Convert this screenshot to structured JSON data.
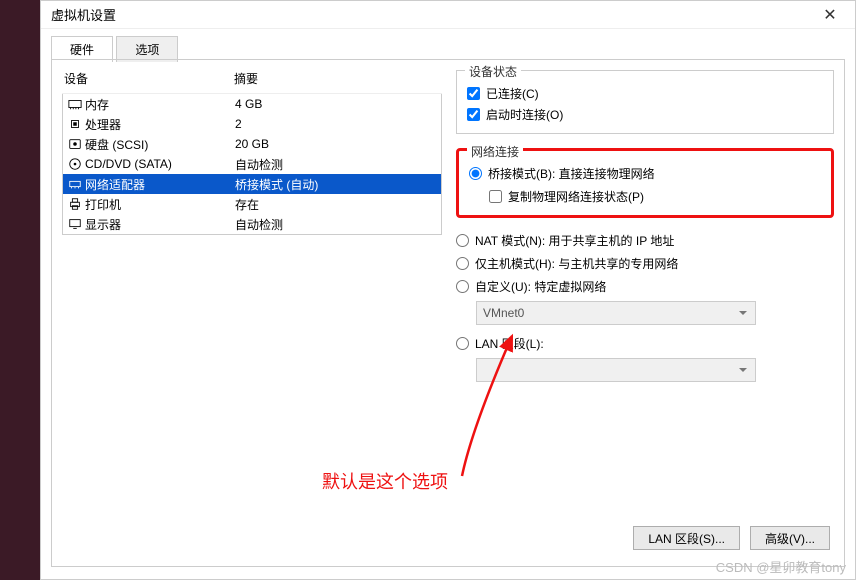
{
  "title": "虚拟机设置",
  "tabs": {
    "hardware": "硬件",
    "options": "选项"
  },
  "headers": {
    "device": "设备",
    "summary": "摘要"
  },
  "devices": [
    {
      "name": "内存",
      "summary": "4 GB",
      "icon": "memory"
    },
    {
      "name": "处理器",
      "summary": "2",
      "icon": "cpu"
    },
    {
      "name": "硬盘 (SCSI)",
      "summary": "20 GB",
      "icon": "disk"
    },
    {
      "name": "CD/DVD (SATA)",
      "summary": "自动检测",
      "icon": "cd"
    },
    {
      "name": "网络适配器",
      "summary": "桥接模式 (自动)",
      "icon": "net",
      "selected": true
    },
    {
      "name": "打印机",
      "summary": "存在",
      "icon": "printer"
    },
    {
      "name": "显示器",
      "summary": "自动检测",
      "icon": "display"
    }
  ],
  "status_group": {
    "legend": "设备状态",
    "connected": "已连接(C)",
    "connect_at_power": "启动时连接(O)"
  },
  "net_group": {
    "legend": "网络连接",
    "bridge": "桥接模式(B): 直接连接物理网络",
    "replicate": "复制物理网络连接状态(P)",
    "nat": "NAT 模式(N): 用于共享主机的 IP 地址",
    "hostonly": "仅主机模式(H): 与主机共享的专用网络",
    "custom": "自定义(U): 特定虚拟网络",
    "vmnet": "VMnet0",
    "lanseg": "LAN 区段(L):"
  },
  "buttons": {
    "lan": "LAN 区段(S)...",
    "adv": "高级(V)..."
  },
  "annotation": "默认是这个选项",
  "watermark": "CSDN @星卯教育tony"
}
